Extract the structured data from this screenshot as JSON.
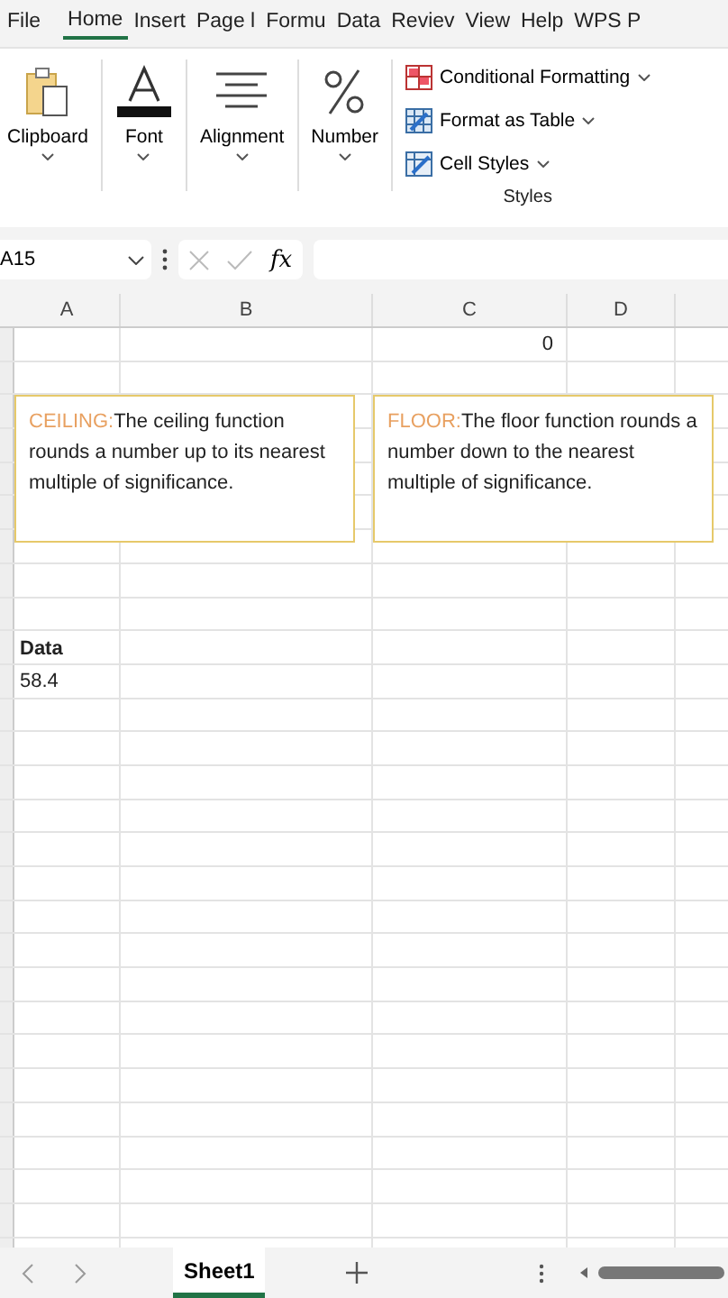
{
  "menu_tabs": [
    {
      "label": "File",
      "selected": false
    },
    {
      "label": "Home",
      "selected": true
    },
    {
      "label": "Insert",
      "selected": false
    },
    {
      "label": "Page l",
      "selected": false
    },
    {
      "label": "Formu",
      "selected": false
    },
    {
      "label": "Data",
      "selected": false
    },
    {
      "label": "Reviev",
      "selected": false
    },
    {
      "label": "View",
      "selected": false
    },
    {
      "label": "Help",
      "selected": false
    },
    {
      "label": "WPS P",
      "selected": false
    }
  ],
  "ribbon": {
    "groups": [
      {
        "kind": "clipboard",
        "label": "Clipboard"
      },
      {
        "kind": "font",
        "label": "Font"
      },
      {
        "kind": "alignment",
        "label": "Alignment"
      },
      {
        "kind": "number",
        "label": "Number"
      }
    ],
    "styles": {
      "items": [
        {
          "kind": "conditional",
          "label": "Conditional Formatting"
        },
        {
          "kind": "table",
          "label": "Format as Table"
        },
        {
          "kind": "cellstyles",
          "label": "Cell Styles"
        }
      ],
      "label": "Styles"
    }
  },
  "formula_bar": {
    "name_box": "A15",
    "function_label": "fx"
  },
  "columns": [
    "A",
    "B",
    "C",
    "D"
  ],
  "cells": [
    {
      "text": "0",
      "bold": false
    },
    {
      "text": "Data",
      "bold": true
    },
    {
      "text": "58.4",
      "bold": false
    }
  ],
  "text_boxes": [
    {
      "title": "CEILING:",
      "body": "The ceiling function rounds a number up to its nearest multiple of significance."
    },
    {
      "title": "FLOOR:",
      "body": "The floor function rounds a number down to the nearest multiple of significance."
    }
  ],
  "sheet_tabs": [
    {
      "label": "Sheet1",
      "selected": true
    }
  ]
}
